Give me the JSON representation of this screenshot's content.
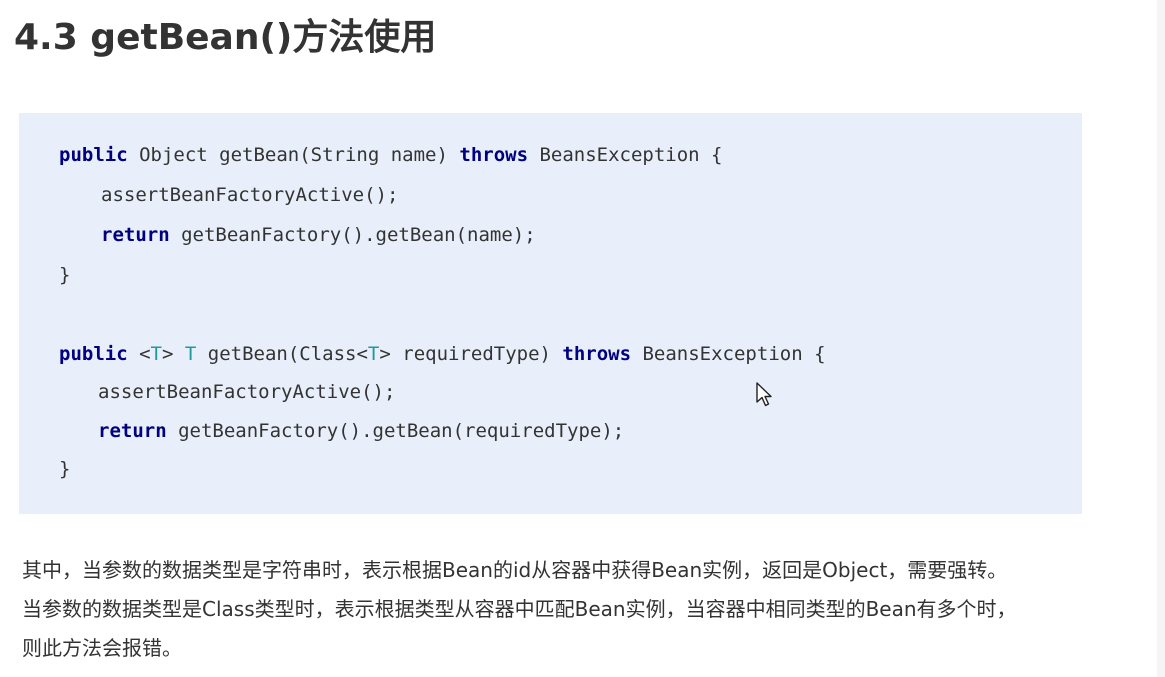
{
  "heading": "4.3 getBean()方法使用",
  "code": {
    "line1": {
      "kw1": "public",
      "rest1": " Object getBean(String name) ",
      "kw2": "throws",
      "rest2": " BeansException {"
    },
    "line2": {
      "text": "assertBeanFactoryActive();"
    },
    "line3": {
      "kw": "return",
      "rest": " getBeanFactory().getBean(name);"
    },
    "line4": {
      "text": "}"
    },
    "line5": {
      "kw1": "public",
      "p1": " <",
      "t1": "T",
      "p2": "> ",
      "t2": "T",
      "p3": " getBean(Class<",
      "t3": "T",
      "p4": "> requiredType) ",
      "kw2": "throws",
      "rest": " BeansException {"
    },
    "line6": {
      "text": "assertBeanFactoryActive();"
    },
    "line7": {
      "kw": "return",
      "rest": " getBeanFactory().getBean(requiredType);"
    },
    "line8": {
      "text": "}"
    }
  },
  "paragraph": {
    "line1": "其中，当参数的数据类型是字符串时，表示根据Bean的id从容器中获得Bean实例，返回是Object，需要强转。",
    "line2": "当参数的数据类型是Class类型时，表示根据类型从容器中匹配Bean实例，当容器中相同类型的Bean有多个时，",
    "line3": "则此方法会报错。"
  },
  "icons": {
    "cursor": "mouse-pointer-icon"
  }
}
